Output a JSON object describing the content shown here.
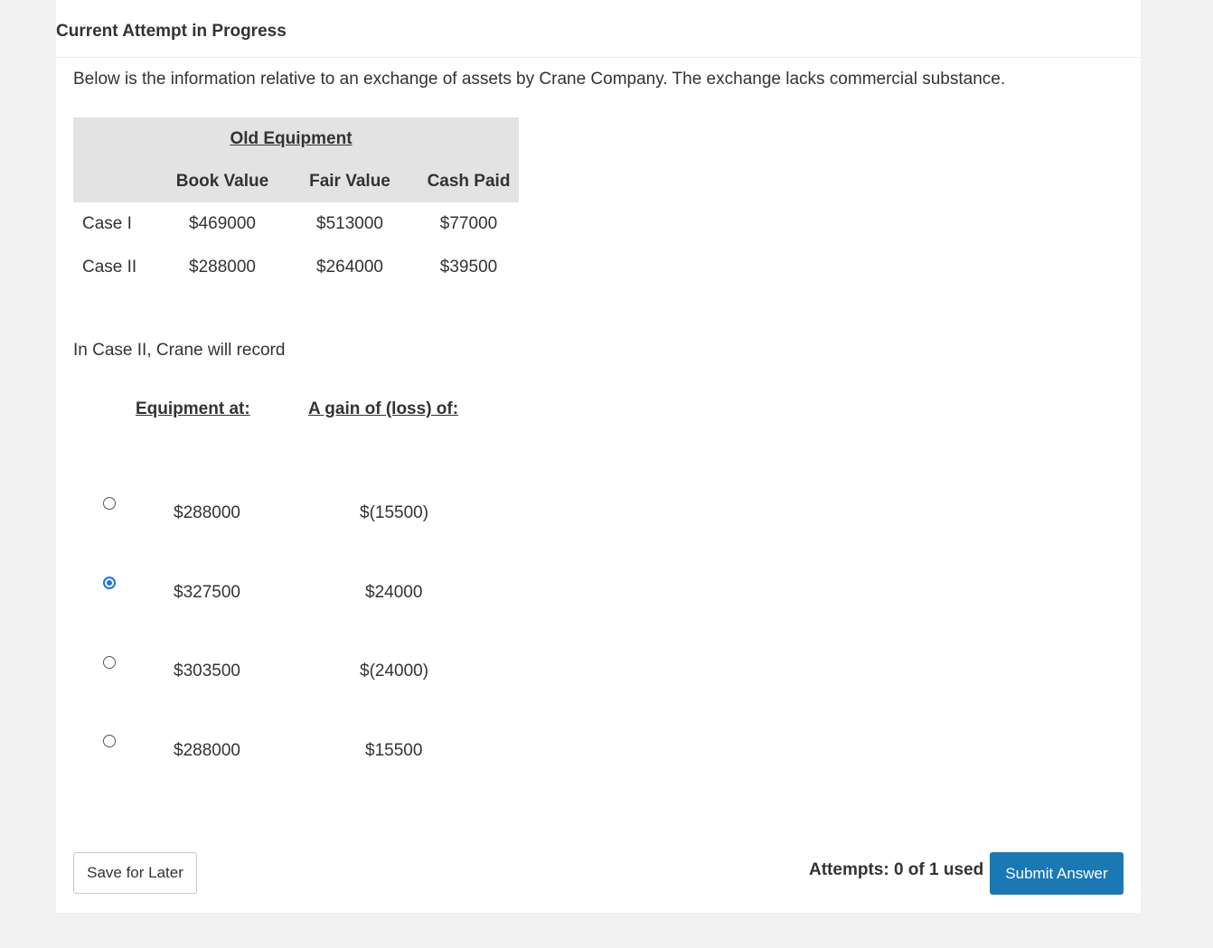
{
  "header": {
    "title": "Current Attempt in Progress"
  },
  "intro": "Below is the information relative to an exchange of assets by Crane Company. The exchange lacks commercial substance.",
  "table": {
    "group_header": "Old Equipment",
    "columns": [
      "Book Value",
      "Fair Value",
      "Cash Paid"
    ],
    "rows": [
      {
        "label": "Case I",
        "book_value": "$469000",
        "fair_value": "$513000",
        "cash_paid": "$77000"
      },
      {
        "label": "Case II",
        "book_value": "$288000",
        "fair_value": "$264000",
        "cash_paid": "$39500"
      }
    ]
  },
  "question": "In Case II, Crane will record",
  "options_header": {
    "equipment": "Equipment at:",
    "gain": "A gain of (loss) of:"
  },
  "options": [
    {
      "equipment": "$288000",
      "gain": "$(15500)",
      "selected": false
    },
    {
      "equipment": "$327500",
      "gain": "$24000",
      "selected": true
    },
    {
      "equipment": "$303500",
      "gain": "$(24000)",
      "selected": false
    },
    {
      "equipment": "$288000",
      "gain": "$15500",
      "selected": false
    }
  ],
  "footer": {
    "save_label": "Save for Later",
    "attempts": "Attempts: 0 of 1 used",
    "submit_label": "Submit Answer"
  },
  "colors": {
    "accent": "#1a78b5",
    "radio_selected": "#1a73e8",
    "table_header_bg": "#e3e3e3"
  }
}
